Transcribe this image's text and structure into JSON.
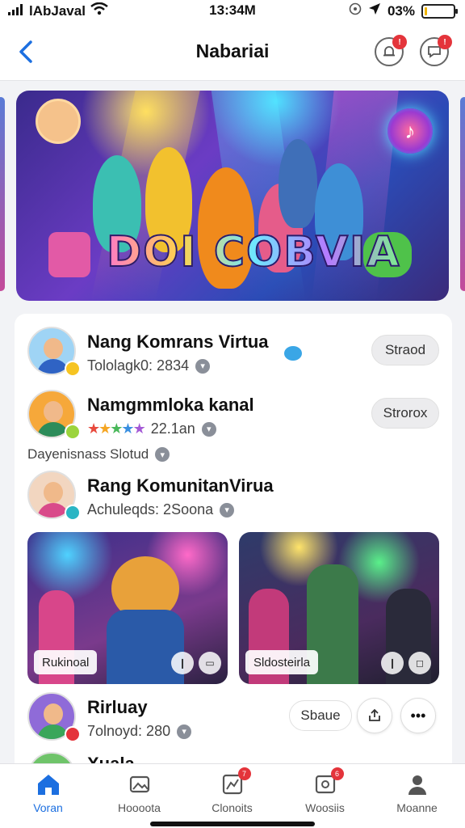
{
  "status_bar": {
    "carrier": "lAbJaval",
    "time": "13:34M",
    "battery_percent": "03%",
    "battery_level": 0.08
  },
  "header": {
    "title": "Nabariai",
    "notification_badge_1": "!",
    "notification_badge_2": "!"
  },
  "banner": {
    "title_text": "DOI COBVIA"
  },
  "rows": [
    {
      "title": "Nang Komrans Virtua",
      "subtitle": "Tololagk0: 2834",
      "button": "Straod"
    },
    {
      "title": "Namgmmloka kanal",
      "subtitle": "22.1an",
      "rating_stars": 5,
      "button": "Strorox",
      "extra_line": "Dayenisnass Slotud"
    },
    {
      "title": "Rang KomunitanVirua",
      "subtitle": "Achuleqds: 2Soona"
    },
    {
      "title": "Rirluay",
      "subtitle": "7olnoyd: 280",
      "button": "Sbaue"
    },
    {
      "title": "Xuala ...",
      "subtitle": ""
    }
  ],
  "photos": [
    {
      "label": "Rukinoal"
    },
    {
      "label": "Sldosteirla"
    }
  ],
  "tabs": [
    {
      "label": "Voran",
      "icon": "home-icon",
      "active": true
    },
    {
      "label": "Hoooota",
      "icon": "gallery-icon",
      "badge": ""
    },
    {
      "label": "Clonoits",
      "icon": "chart-icon",
      "badge": "7"
    },
    {
      "label": "Woosiis",
      "icon": "game-icon",
      "badge": "6"
    },
    {
      "label": "Moanne",
      "icon": "profile-icon"
    }
  ],
  "colors": {
    "accent": "#1c6fe0",
    "badge": "#e4343b"
  }
}
